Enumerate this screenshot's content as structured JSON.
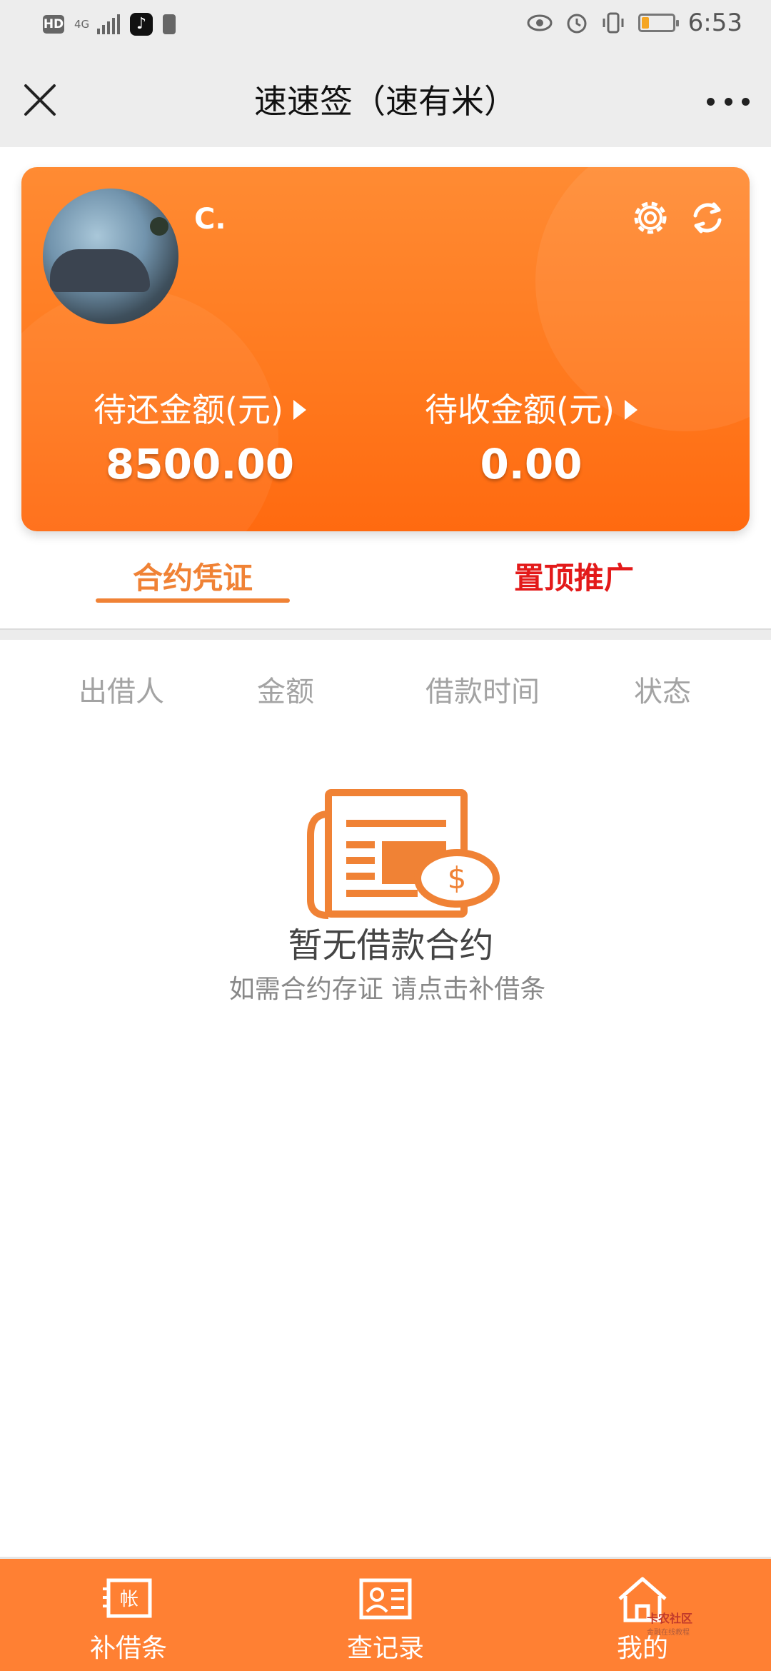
{
  "statusbar": {
    "hd": "HD",
    "network": "4G",
    "time": "6:53",
    "battery_level": 0.22
  },
  "navbar": {
    "title": "速速签（速有米）"
  },
  "card": {
    "username": "C.",
    "pending_repay_label": "待还金额(元)",
    "pending_repay_value": "8500.00",
    "pending_receive_label": "待收金额(元)",
    "pending_receive_value": "0.00"
  },
  "tabs": {
    "contract": "合约凭证",
    "promotion": "置顶推广"
  },
  "table": {
    "headers": [
      "出借人",
      "金额",
      "借款时间",
      "状态"
    ]
  },
  "empty": {
    "title": "暂无借款合约",
    "subtitle": "如需合约存证 请点击补借条",
    "icon_text": "$"
  },
  "bottom_nav": {
    "items": [
      {
        "label": "补借条",
        "icon": "account-note-icon",
        "icon_text": "帐"
      },
      {
        "label": "查记录",
        "icon": "id-card-icon"
      },
      {
        "label": "我的",
        "icon": "home-icon"
      }
    ]
  },
  "watermark": {
    "line1": "卡农社区",
    "line2": "金融在线教程"
  },
  "colors": {
    "accent": "#ff8033",
    "tab_active": "#f08235",
    "promo_red": "#e31a1a"
  }
}
